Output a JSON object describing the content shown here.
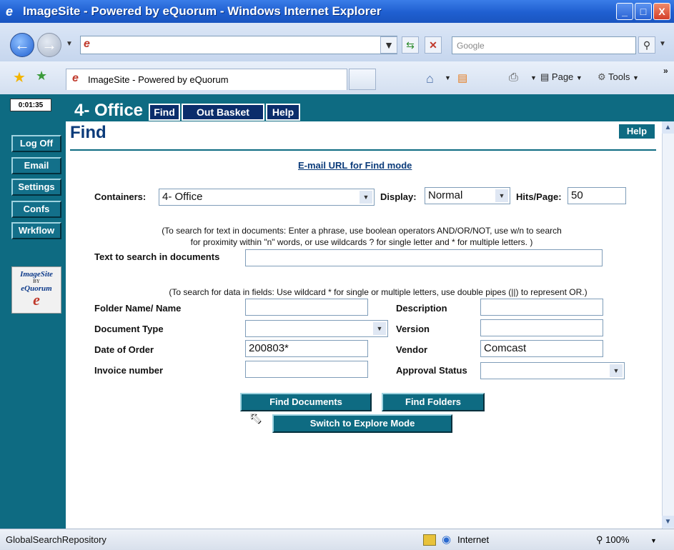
{
  "window": {
    "title": "ImageSite - Powered by eQuorum - Windows Internet Explorer",
    "minimize": "_",
    "maximize": "□",
    "close": "X"
  },
  "browser": {
    "address_value": "",
    "search_placeholder": "Google",
    "tab_label": "ImageSite - Powered by eQuorum",
    "page_menu": "Page",
    "tools_menu": "Tools",
    "more": "»"
  },
  "app": {
    "clock": "0:01:35",
    "office_title": "4- Office",
    "top_tabs": [
      "Find",
      "Out Basket",
      "Help"
    ],
    "sidebar": [
      "Log Off",
      "Email",
      "Settings",
      "Confs",
      "Wrkflow"
    ],
    "logo": {
      "line1": "ImageSite",
      "line2": "BY",
      "line3": "eQuorum"
    }
  },
  "find": {
    "heading": "Find",
    "help_button": "Help",
    "email_link": "E-mail URL for Find mode",
    "containers_label": "Containers:",
    "containers_value": "4- Office",
    "display_label": "Display:",
    "display_value": "Normal",
    "hits_label": "Hits/Page:",
    "hits_value": "50",
    "text_note_1": "(To search for text in documents: Enter a phrase, use boolean operators AND/OR/NOT, use w/n to search",
    "text_note_2": "for proximity within \"n\" words, or use wildcards ? for single letter and * for multiple letters. )",
    "text_label": "Text to search in documents",
    "text_value": "",
    "fields_note": "(To search for data in fields: Use wildcard * for single or multiple letters, use double pipes (||) to represent OR.)",
    "fields": {
      "folder_label": "Folder Name/ Name",
      "folder_value": "",
      "description_label": "Description",
      "description_value": "",
      "doctype_label": "Document Type",
      "doctype_value": "",
      "version_label": "Version",
      "version_value": "",
      "date_label": "Date of Order",
      "date_value": "200803*",
      "vendor_label": "Vendor",
      "vendor_value": "Comcast",
      "invoice_label": "Invoice number",
      "invoice_value": "",
      "approval_label": "Approval Status",
      "approval_value": ""
    },
    "buttons": {
      "find_documents": "Find Documents",
      "find_folders": "Find Folders",
      "explore_mode": "Switch to Explore Mode"
    }
  },
  "status": {
    "text": "GlobalSearchRepository",
    "zone": "Internet",
    "zoom": "100%"
  }
}
